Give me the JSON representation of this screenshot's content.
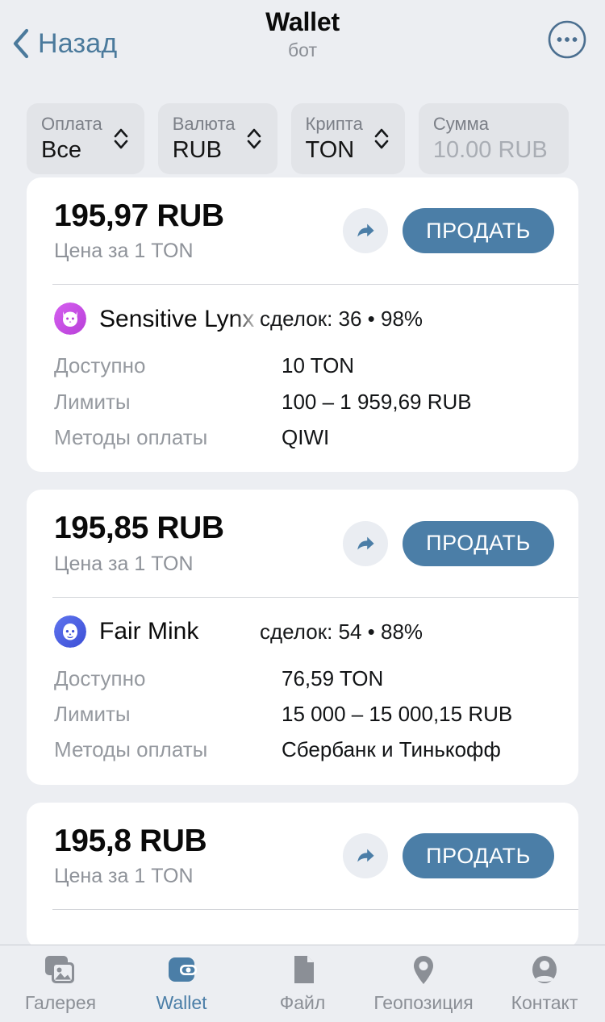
{
  "header": {
    "back_label": "Назад",
    "back_icon": "chevron-left-icon",
    "title": "Wallet",
    "subtitle": "бот",
    "menu_icon": "more-options-icon"
  },
  "filters": [
    {
      "label": "Оплата",
      "value": "Все",
      "is_placeholder": false,
      "icon": "chevron-updown-icon"
    },
    {
      "label": "Валюта",
      "value": "RUB",
      "is_placeholder": false,
      "icon": "chevron-updown-icon"
    },
    {
      "label": "Крипта",
      "value": "TON",
      "is_placeholder": false,
      "icon": "chevron-updown-icon"
    },
    {
      "label": "Сумма",
      "value": "10.00 RUB",
      "is_placeholder": true,
      "icon": ""
    }
  ],
  "offers": [
    {
      "price": "195,97 RUB",
      "price_sub": "Цена за 1 TON",
      "share_icon": "share-arrow-icon",
      "action_label": "ПРОДАТЬ",
      "seller_name": "Sensitive Lynx",
      "seller_avatar_icon": "lynx-avatar-icon",
      "seller_avatar_color": "#c94fe0",
      "seller_stats": "сделок: 36 • 98%",
      "details": [
        {
          "key": "Доступно",
          "value": "10 TON"
        },
        {
          "key": "Лимиты",
          "value": "100 – 1 959,69 RUB"
        },
        {
          "key": "Методы оплаты",
          "value": "QIWI"
        }
      ]
    },
    {
      "price": "195,85 RUB",
      "price_sub": "Цена за 1 TON",
      "share_icon": "share-arrow-icon",
      "action_label": "ПРОДАТЬ",
      "seller_name": "Fair Mink",
      "seller_avatar_icon": "mink-avatar-icon",
      "seller_avatar_color": "#4a5fe0",
      "seller_stats": "сделок: 54 • 88%",
      "details": [
        {
          "key": "Доступно",
          "value": "76,59 TON"
        },
        {
          "key": "Лимиты",
          "value": "15 000 – 15 000,15 RUB"
        },
        {
          "key": "Методы оплаты",
          "value": "Сбербанк и Тинькофф"
        }
      ]
    },
    {
      "price": "195,8 RUB",
      "price_sub": "Цена за 1 TON",
      "share_icon": "share-arrow-icon",
      "action_label": "ПРОДАТЬ"
    }
  ],
  "tabbar": [
    {
      "label": "Галерея",
      "icon": "gallery-icon",
      "active": false
    },
    {
      "label": "Wallet",
      "icon": "wallet-icon",
      "active": true
    },
    {
      "label": "Файл",
      "icon": "file-icon",
      "active": false
    },
    {
      "label": "Геопозиция",
      "icon": "location-icon",
      "active": false
    },
    {
      "label": "Контакт",
      "icon": "contact-icon",
      "active": false
    }
  ],
  "colors": {
    "accent": "#4b7ea7",
    "page_bg": "#eceef2",
    "card_bg": "#ffffff",
    "muted_text": "#8e9299"
  }
}
